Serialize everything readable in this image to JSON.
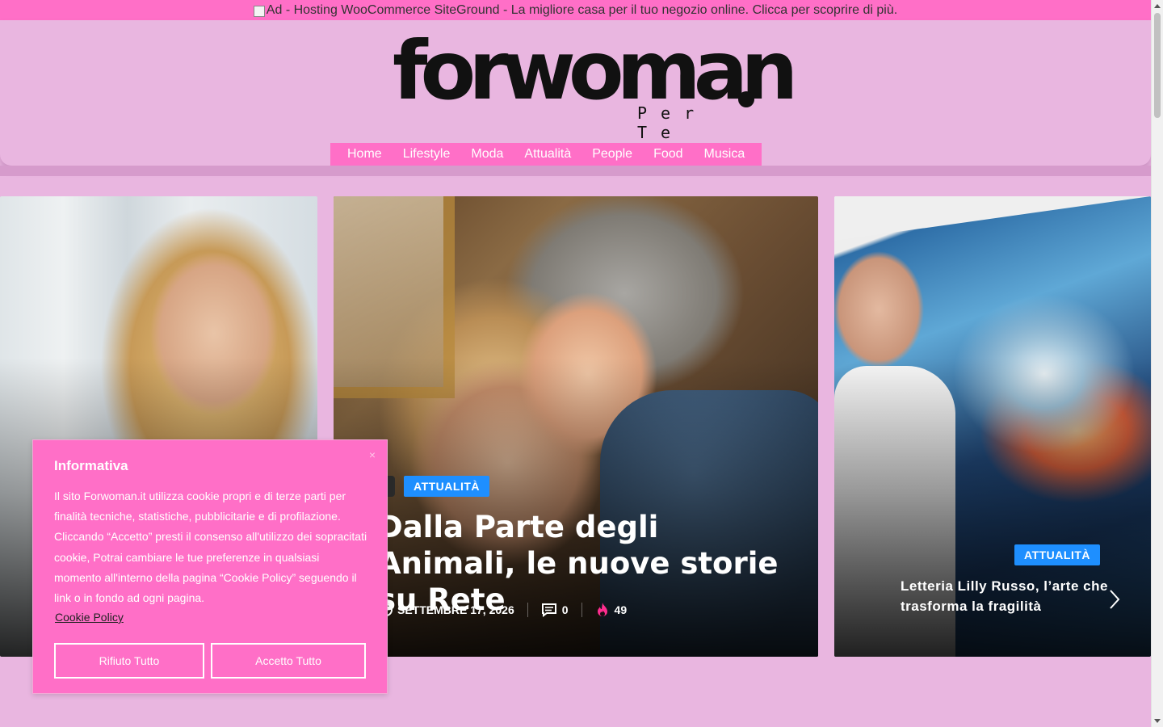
{
  "ad": {
    "alt_text": "Ad - Hosting WooCommerce SiteGround - La migliore casa per il tuo negozio online. Clicca per scoprire di più."
  },
  "header": {
    "logo_text": "forwoman",
    "tagline": "Per Te"
  },
  "nav": {
    "items": [
      "Home",
      "Lifestyle",
      "Moda",
      "Attualità",
      "People",
      "Food",
      "Musica"
    ]
  },
  "slider": {
    "center": {
      "category": "ATTUALITÀ",
      "title": "Dalla Parte degli Animali, le nuove storie su Rete",
      "date": "SETTEMBRE 17, 2026",
      "comments": "0",
      "views": "49"
    },
    "right": {
      "category": "ATTUALITÀ",
      "title": "Letteria Lilly Russo, l’arte che trasforma la fragilità"
    }
  },
  "cookie": {
    "title": "Informativa",
    "text": "Il sito Forwoman.it utilizza cookie propri e di terze parti per finalità tecniche, statistiche, pubblicitarie e di profilazione. Cliccando “Accetto” presti il consenso all'utilizzo dei sopracitati cookie, Potrai cambiare le tue preferenze in qualsiasi momento all'interno della pagina “Cookie Policy” seguendo il link o in fondo ad ogni pagina.",
    "link_label": "Cookie Policy",
    "reject_label": "Rifiuto Tutto",
    "accept_label": "Accetto Tutto",
    "close_label": "×"
  },
  "colors": {
    "page_bg": "#e9b6e0",
    "accent_pink": "#ff6fc7",
    "badge_blue": "#1e8fff",
    "fire_pink": "#ff2d8f"
  }
}
